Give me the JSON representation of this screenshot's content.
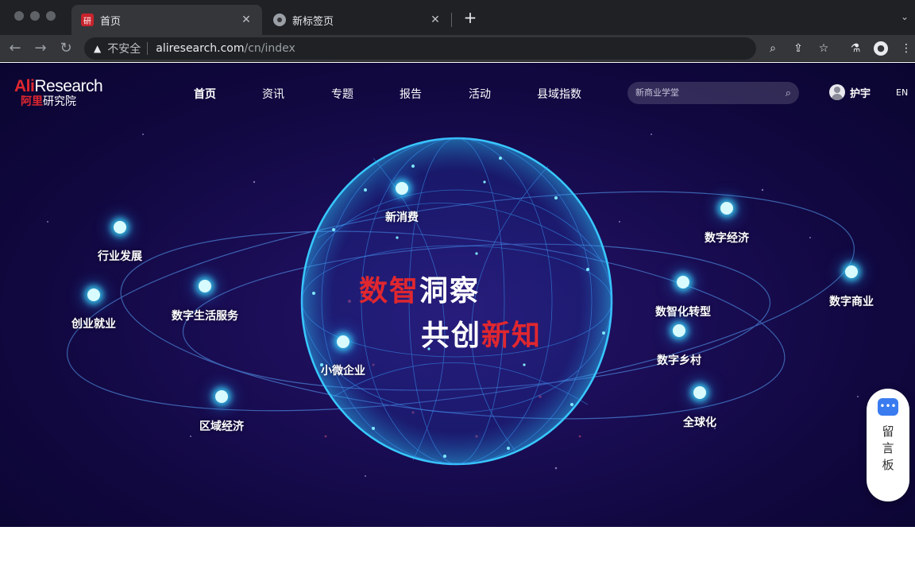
{
  "browser": {
    "tabs": [
      {
        "title": "首页",
        "icon": "site-favicon-icon",
        "active": true
      },
      {
        "title": "新标签页",
        "icon": "chrome-icon",
        "active": false
      }
    ],
    "address": {
      "security_label": "不安全",
      "host": "aliresearch.com",
      "path": "/cn/index"
    }
  },
  "site": {
    "logo": {
      "ali": "Ali",
      "research": "Research",
      "cn_red": "阿里",
      "cn_white": "研究院"
    },
    "nav": [
      "首页",
      "资讯",
      "专题",
      "报告",
      "活动",
      "县域指数"
    ],
    "search_placeholder": "新商业学堂",
    "user_name": "护宇",
    "lang": "EN",
    "slogan": {
      "line1_red": "数智",
      "line1_white": "洞察",
      "line2_white": "共创",
      "line2_red": "新知"
    },
    "topics": [
      "新消费",
      "行业发展",
      "数字生活服务",
      "创业就业",
      "小微企业",
      "区域经济",
      "数字经济",
      "数字商业",
      "数智化转型",
      "数字乡村",
      "全球化"
    ],
    "message_board": "留言板"
  },
  "colors": {
    "accent_red": "#e0272f",
    "node_glow": "#3cdcff",
    "background": "#1a0d55"
  }
}
